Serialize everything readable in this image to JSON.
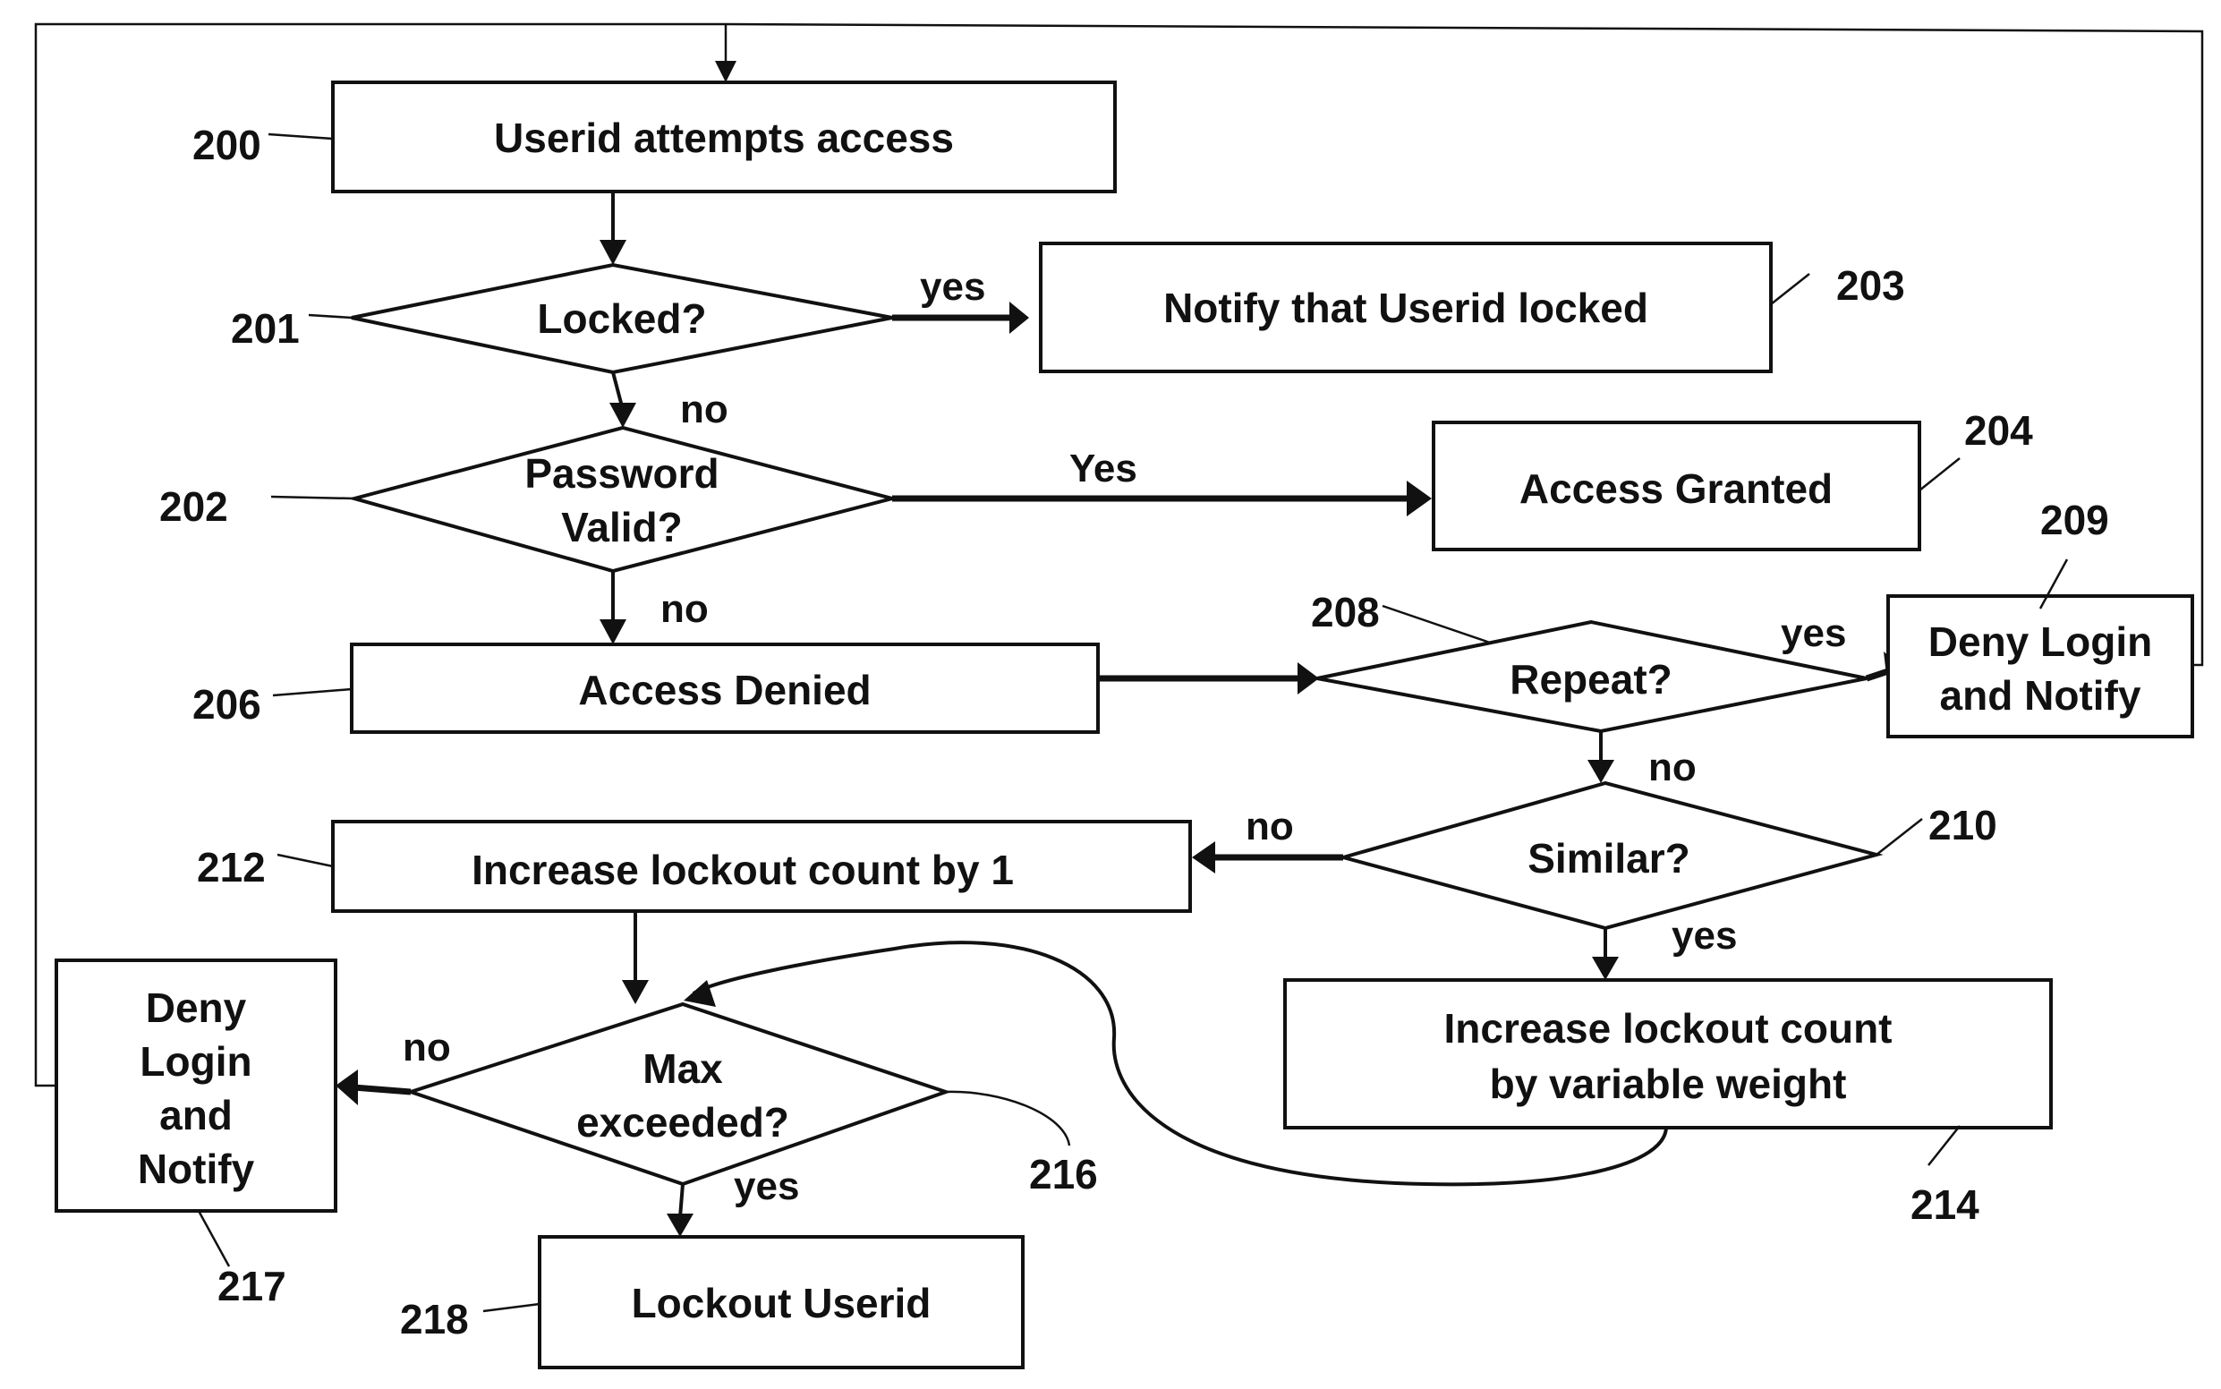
{
  "diagram": {
    "type": "flowchart",
    "nodes": {
      "n200": {
        "ref": "200",
        "shape": "process",
        "lines": [
          "Userid attempts access"
        ]
      },
      "n201": {
        "ref": "201",
        "shape": "decision",
        "lines": [
          "Locked?"
        ]
      },
      "n203": {
        "ref": "203",
        "shape": "process",
        "lines": [
          "Notify that Userid locked"
        ]
      },
      "n202": {
        "ref": "202",
        "shape": "decision",
        "lines": [
          "Password",
          "Valid?"
        ]
      },
      "n204": {
        "ref": "204",
        "shape": "process",
        "lines": [
          "Access Granted"
        ]
      },
      "n206": {
        "ref": "206",
        "shape": "process",
        "lines": [
          "Access Denied"
        ]
      },
      "n208": {
        "ref": "208",
        "shape": "decision",
        "lines": [
          "Repeat?"
        ]
      },
      "n209": {
        "ref": "209",
        "shape": "process",
        "lines": [
          "Deny Login",
          "and Notify"
        ]
      },
      "n210": {
        "ref": "210",
        "shape": "decision",
        "lines": [
          "Similar?"
        ]
      },
      "n212": {
        "ref": "212",
        "shape": "process",
        "lines": [
          "Increase lockout count by 1"
        ]
      },
      "n214": {
        "ref": "214",
        "shape": "process",
        "lines": [
          "Increase lockout count",
          "by variable weight"
        ]
      },
      "n216": {
        "ref": "216",
        "shape": "decision",
        "lines": [
          "Max",
          "exceeded?"
        ]
      },
      "n217": {
        "ref": "217",
        "shape": "process",
        "lines": [
          "Deny",
          "Login",
          "and",
          "Notify"
        ]
      },
      "n218": {
        "ref": "218",
        "shape": "process",
        "lines": [
          "Lockout Userid"
        ]
      }
    },
    "edges": [
      {
        "from": "200",
        "to": "201",
        "label": ""
      },
      {
        "from": "201",
        "to": "203",
        "label": "yes"
      },
      {
        "from": "201",
        "to": "202",
        "label": "no"
      },
      {
        "from": "202",
        "to": "204",
        "label": "Yes"
      },
      {
        "from": "202",
        "to": "206",
        "label": "no"
      },
      {
        "from": "206",
        "to": "208",
        "label": ""
      },
      {
        "from": "208",
        "to": "209",
        "label": "yes"
      },
      {
        "from": "208",
        "to": "210",
        "label": "no"
      },
      {
        "from": "210",
        "to": "212",
        "label": "no"
      },
      {
        "from": "210",
        "to": "214",
        "label": "yes"
      },
      {
        "from": "212",
        "to": "216",
        "label": ""
      },
      {
        "from": "214",
        "to": "216",
        "label": ""
      },
      {
        "from": "216",
        "to": "217",
        "label": "no"
      },
      {
        "from": "216",
        "to": "218",
        "label": "yes"
      },
      {
        "from": "209",
        "to": "200",
        "label": ""
      },
      {
        "from": "217",
        "to": "200",
        "label": ""
      }
    ],
    "edge_labels": {
      "e201_yes": "yes",
      "e201_no": "no",
      "e202_yes": "Yes",
      "e202_no": "no",
      "e208_yes": "yes",
      "e208_no": "no",
      "e210_no": "no",
      "e210_yes": "yes",
      "e216_no": "no",
      "e216_yes": "yes"
    }
  }
}
